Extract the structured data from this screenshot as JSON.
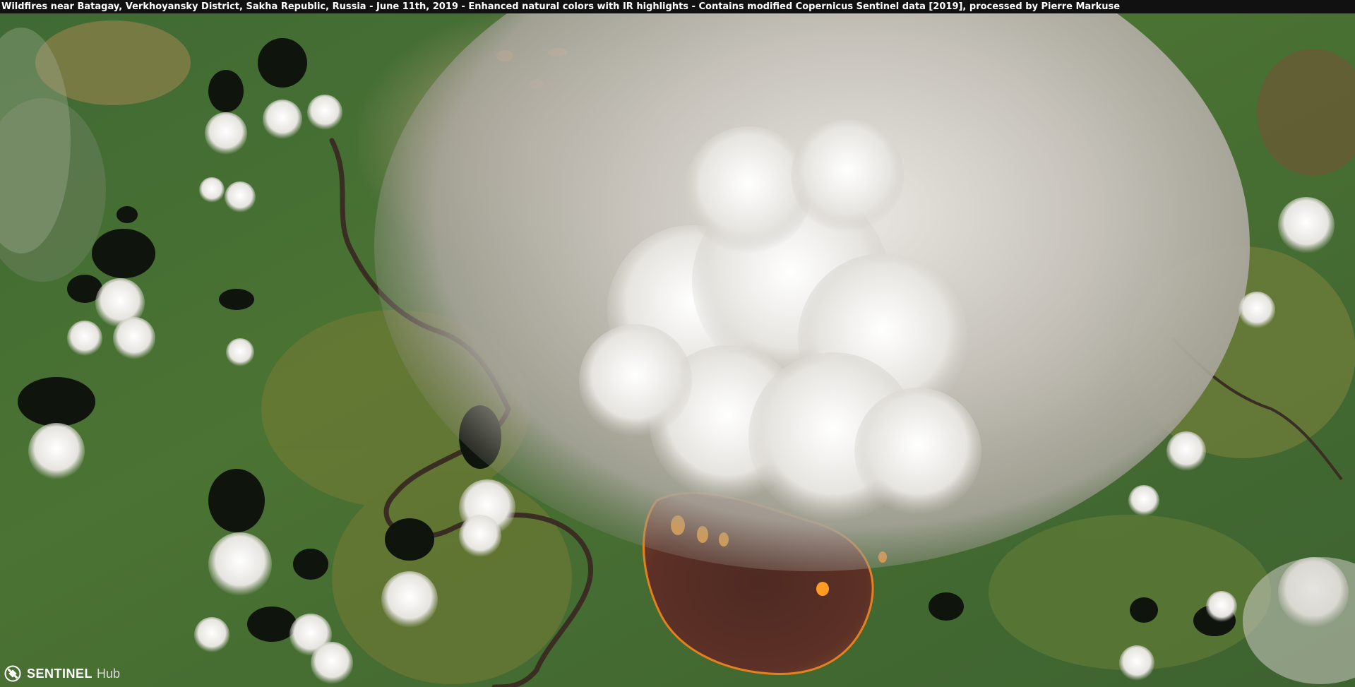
{
  "caption": {
    "text": "Wildfires near Batagay, Verkhoyansky District, Sakha Republic, Russia - June 11th, 2019 - Enhanced natural colors with IR highlights - Contains modified Copernicus Sentinel data [2019], processed by Pierre Markuse"
  },
  "logo": {
    "brand": "SENTINEL",
    "sub": "Hub",
    "icon": "satellite-icon"
  },
  "colors": {
    "vegetation": "#4a6b2f",
    "vegetation_light": "#6f8a3a",
    "burn_scar": "#5a2e22",
    "fire": "#ff8a1a",
    "smoke": "#b8b4ad",
    "cloud": "#f2f2f0",
    "lake": "#0f140c",
    "river": "#3a2e22"
  }
}
